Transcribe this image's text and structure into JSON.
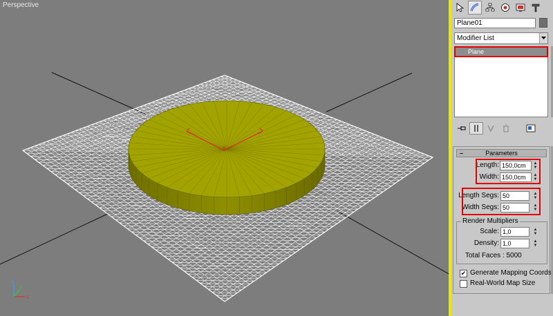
{
  "viewport": {
    "label": "Perspective"
  },
  "object": {
    "name": "Plane01",
    "color_swatch": "#6f6f6f"
  },
  "modifier_list": {
    "label": "Modifier List",
    "stack_item": "Plane"
  },
  "parameters": {
    "title": "Parameters",
    "length_label": "Length:",
    "length_value": "150,0cm",
    "width_label": "Width:",
    "width_value": "150,0cm",
    "length_segs_label": "Length Segs:",
    "length_segs_value": "50",
    "width_segs_label": "Width Segs:",
    "width_segs_value": "50",
    "render_multipliers_title": "Render Multipliers",
    "scale_label": "Scale:",
    "scale_value": "1,0",
    "density_label": "Density:",
    "density_value": "1,0",
    "total_faces": "Total Faces : 5000",
    "generate_mapping_label": "Generate Mapping Coords.",
    "generate_mapping_checked": true,
    "real_world_label": "Real-World Map Size",
    "real_world_checked": false
  },
  "colors": {
    "viewport_bg": "#7d7d7d",
    "active_border": "#e8e800",
    "highlight_red": "#e00000",
    "cylinder": "#9c9c00",
    "wireframe": "#ffffff"
  },
  "icons": {
    "tabs": [
      "create-icon",
      "modify-icon",
      "hierarchy-icon",
      "motion-icon",
      "display-icon",
      "utilities-icon"
    ],
    "stack_tools": [
      "pin-stack-icon",
      "show-end-result-icon",
      "make-unique-icon",
      "remove-modifier-icon",
      "configure-sets-icon"
    ]
  }
}
